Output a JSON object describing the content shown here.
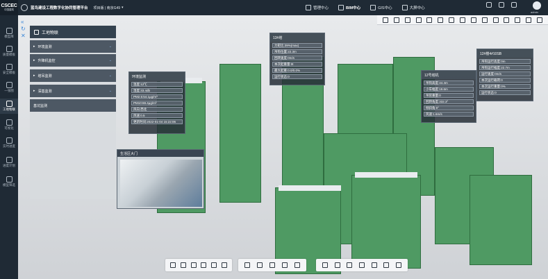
{
  "app": {
    "logo_text": "CSCEC",
    "logo_sub": "中国建筑",
    "title": "蓝鸟建设工程数字化协同管理平台",
    "project": "项目版 | 南京G49"
  },
  "top_nav": [
    {
      "label": "管理中心",
      "icon": "monitor-icon"
    },
    {
      "label": "BIM中心",
      "icon": "cube-icon"
    },
    {
      "label": "GIS中心",
      "icon": "globe-icon"
    },
    {
      "label": "大屏中心",
      "icon": "screen-icon"
    }
  ],
  "user": {
    "name": "admin"
  },
  "sidebar": [
    {
      "label": "模型库",
      "icon": "model-icon"
    },
    {
      "label": "质量模板",
      "icon": "quality-icon"
    },
    {
      "label": "安全模板",
      "icon": "safety-icon"
    },
    {
      "label": "一张图",
      "icon": "map-icon"
    },
    {
      "label": "工地物联",
      "icon": "iot-icon",
      "active": true
    },
    {
      "label": "可视化",
      "icon": "visual-icon"
    },
    {
      "label": "实时进度",
      "icon": "progress-icon"
    },
    {
      "label": "进度计划",
      "icon": "plan-icon"
    },
    {
      "label": "模型筛选",
      "icon": "filter-icon"
    }
  ],
  "panel": {
    "title": "工地物联",
    "items": [
      "环境监测",
      "升降机监控",
      "塔吊监测",
      "深基监测",
      "基坑监测"
    ]
  },
  "env_card": {
    "title": "环境监测",
    "rows": [
      "温度:12℃",
      "湿度:33.4db",
      "PM2.5:54.1μg/m³",
      "PM10:69.4μg/m³",
      "风向:西北",
      "风速:0.5",
      "更新时间:2022-01-04 15:22:06"
    ]
  },
  "tower13": {
    "title": "13#塔",
    "rows": [
      "力矩比:39%(max)",
      "吊钩位置:22.3m",
      "回转速度:0m/s",
      "本次起重量:0t",
      "最大起重:0.0/0.0%",
      "运行状态:0"
    ]
  },
  "tower12": {
    "title": "12号塔机",
    "rows": [
      "吊钩高度:44.4m",
      "小车幅度:19.6m",
      "吊装重量:0",
      "回转角度:332.3°",
      "倾斜角:0°",
      "风速:1.6m/s"
    ]
  },
  "building12": {
    "title": "12#楼4#10SB",
    "rows": [
      "吊钩运行高度:0m",
      "吊钩运行幅度:22.7m",
      "运行速度:0m/s",
      "本次运行载荷:0",
      "本次运行重量:0%",
      "运行状态:0"
    ]
  },
  "camera": {
    "title": "生活区大门"
  },
  "toolbar_icons": [
    "globe-icon",
    "settings-icon",
    "table-icon",
    "columns-icon",
    "layers-icon",
    "paperclip-icon",
    "draw-icon",
    "tag-icon",
    "star-icon",
    "calendar-icon",
    "flag-icon",
    "picture-icon",
    "filter-icon",
    "tool-icon",
    "ruler-icon"
  ],
  "bottom_bar1": [
    "pointer-icon",
    "cube-plus-icon",
    "house-icon",
    "box-icon",
    "cube-icon",
    "tree-icon"
  ],
  "bottom_bar2": [
    "briefcase-icon",
    "ruler-icon",
    "crop-icon",
    "expand-icon",
    "grid-icon"
  ],
  "bottom_bar3": [
    "settings-icon",
    "eye-off-icon",
    "eye-icon",
    "copy-icon",
    "focus-icon",
    "export-icon",
    "layers-icon"
  ]
}
